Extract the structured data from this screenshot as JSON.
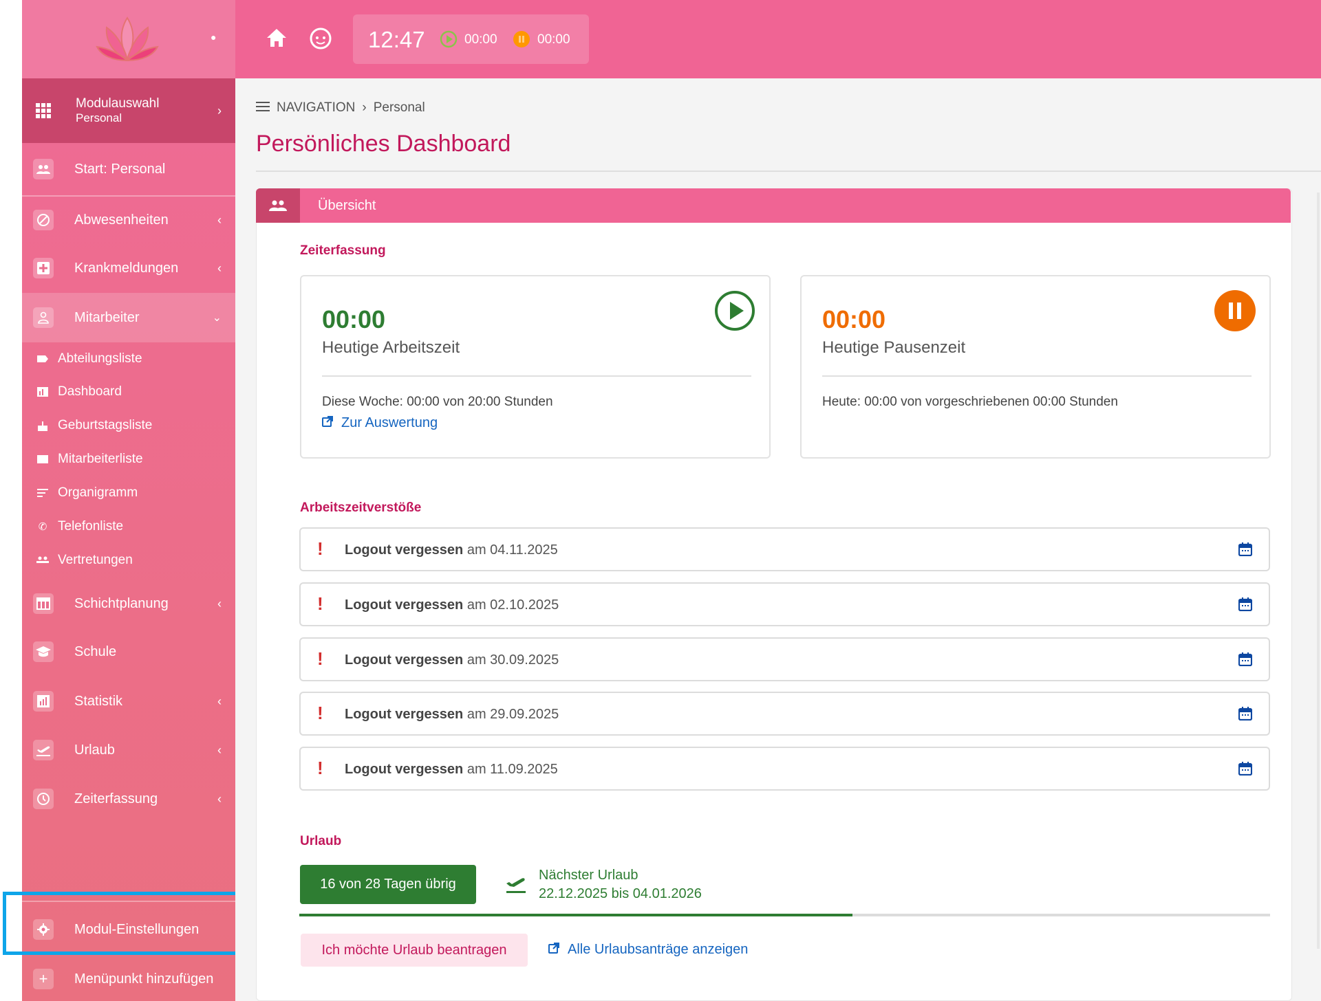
{
  "colors": {
    "brand": "#f06494",
    "title": "#c2185b",
    "green": "#2e7d32",
    "orange": "#ef6c00",
    "blue": "#1565c0",
    "highlight": "#0ea5e9"
  },
  "topbar": {
    "clock": "12:47",
    "work_timer": "00:00",
    "break_timer": "00:00"
  },
  "sidebar": {
    "module": {
      "title": "Modulauswahl",
      "subtitle": "Personal"
    },
    "items": [
      {
        "label": "Start: Personal",
        "icon": "people-icon"
      },
      {
        "label": "Abwesenheiten",
        "icon": "block-icon"
      },
      {
        "label": "Krankmeldungen",
        "icon": "medical-icon"
      },
      {
        "label": "Mitarbeiter",
        "icon": "person-icon"
      }
    ],
    "subitems": [
      {
        "label": "Abteilungsliste"
      },
      {
        "label": "Dashboard"
      },
      {
        "label": "Geburtstagsliste"
      },
      {
        "label": "Mitarbeiterliste"
      },
      {
        "label": "Organigramm"
      },
      {
        "label": "Telefonliste"
      },
      {
        "label": "Vertretungen"
      }
    ],
    "items2": [
      {
        "label": "Schichtplanung"
      },
      {
        "label": "Schule"
      },
      {
        "label": "Statistik"
      },
      {
        "label": "Urlaub"
      },
      {
        "label": "Zeiterfassung"
      }
    ],
    "bottom": [
      {
        "label": "Modul-Einstellungen"
      },
      {
        "label": "Menüpunkt hinzufügen"
      }
    ]
  },
  "breadcrumb": {
    "root": "NAVIGATION",
    "current": "Personal"
  },
  "page_title": "Persönliches Dashboard",
  "panel": {
    "header": "Übersicht",
    "time_section": "Zeiterfassung",
    "work": {
      "value": "00:00",
      "label": "Heutige Arbeitszeit",
      "week": "Diese Woche: 00:00 von 20:00 Stunden",
      "link": "Zur Auswertung"
    },
    "pause": {
      "value": "00:00",
      "label": "Heutige Pausenzeit",
      "today": "Heute: 00:00 von vorgeschriebenen 00:00 Stunden"
    },
    "violations_section": "Arbeitszeitverstöße",
    "violations": [
      {
        "type": "Logout vergessen",
        "date": "am 04.11.2025"
      },
      {
        "type": "Logout vergessen",
        "date": "am 02.10.2025"
      },
      {
        "type": "Logout vergessen",
        "date": "am 30.09.2025"
      },
      {
        "type": "Logout vergessen",
        "date": "am 29.09.2025"
      },
      {
        "type": "Logout vergessen",
        "date": "am 11.09.2025"
      }
    ],
    "vacation_section": "Urlaub",
    "vacation": {
      "badge": "16 von 28 Tagen übrig",
      "next_label": "Nächster Urlaub",
      "next_range": "22.12.2025 bis 04.01.2026",
      "used_fraction": 0.57,
      "request_button": "Ich möchte Urlaub beantragen",
      "all_link": "Alle Urlaubsanträge anzeigen"
    }
  }
}
